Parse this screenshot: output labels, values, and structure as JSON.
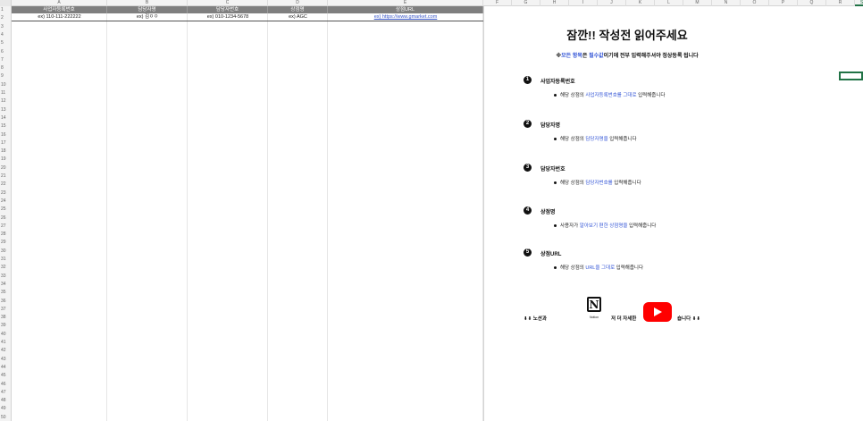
{
  "columns": [
    "A",
    "B",
    "C",
    "D",
    "E",
    "F",
    "G",
    "H",
    "I",
    "J",
    "K",
    "L",
    "M",
    "N",
    "O",
    "P",
    "Q",
    "R",
    "S"
  ],
  "rows": [
    "1",
    "2",
    "3",
    "4",
    "5",
    "6",
    "7",
    "8",
    "9",
    "10",
    "11",
    "12",
    "13",
    "14",
    "15",
    "16",
    "17",
    "18",
    "19",
    "20",
    "21",
    "22",
    "23",
    "24",
    "25",
    "26",
    "27",
    "28",
    "29",
    "30",
    "31",
    "32",
    "33",
    "34",
    "35",
    "36",
    "37",
    "38",
    "39",
    "40",
    "41",
    "42",
    "43",
    "44",
    "45",
    "46",
    "47",
    "48",
    "49",
    "50"
  ],
  "table": {
    "headers": [
      "사업자등록번호",
      "담당자명",
      "담당자번호",
      "상점명",
      "상점URL"
    ],
    "example": [
      "ex) 110-111-222222",
      "ex) 김ㅇㅇ",
      "ex) 010-1234-5678",
      "ex) AGC",
      "ex)   https://www.gmarket.com"
    ]
  },
  "panel": {
    "title": "잠깐!! 작성전 읽어주세요",
    "notice_prefix": "※",
    "notice_hl1": "모든 항목",
    "notice_mid": "은 ",
    "notice_hl2": "필수값",
    "notice_suffix": "이기에 전부 입력해주셔야 정상등록 됩니다",
    "items": [
      {
        "num": "1",
        "head": "사업자등록번호",
        "pre": "해당 상점의 ",
        "hl": "사업자등록번호를 그대로",
        "post": " 입력해줍니다"
      },
      {
        "num": "2",
        "head": "담당자명",
        "pre": "해당 상점의 ",
        "hl": "담당자명을",
        "post": " 입력해줍니다"
      },
      {
        "num": "3",
        "head": "담당자번호",
        "pre": "해당 상점의 ",
        "hl": "담당자번호를",
        "post": " 입력해줍니다"
      },
      {
        "num": "4",
        "head": "상점명",
        "pre": "사용자가 ",
        "hl": "알아보기 편한 상점명을",
        "post": " 입력해줍니다"
      },
      {
        "num": "5",
        "head": "상점URL",
        "pre": "해당 상점의 ",
        "hl": "URL을 그대로",
        "post": " 입력해줍니다"
      }
    ],
    "footer": {
      "arrows_left": "⬇⬇ 노션과",
      "notion_letter": "N",
      "notion_caption": "Notion",
      "middle": "저 더 자세한",
      "arrows_right": "숍니다 ⬇⬇"
    }
  }
}
